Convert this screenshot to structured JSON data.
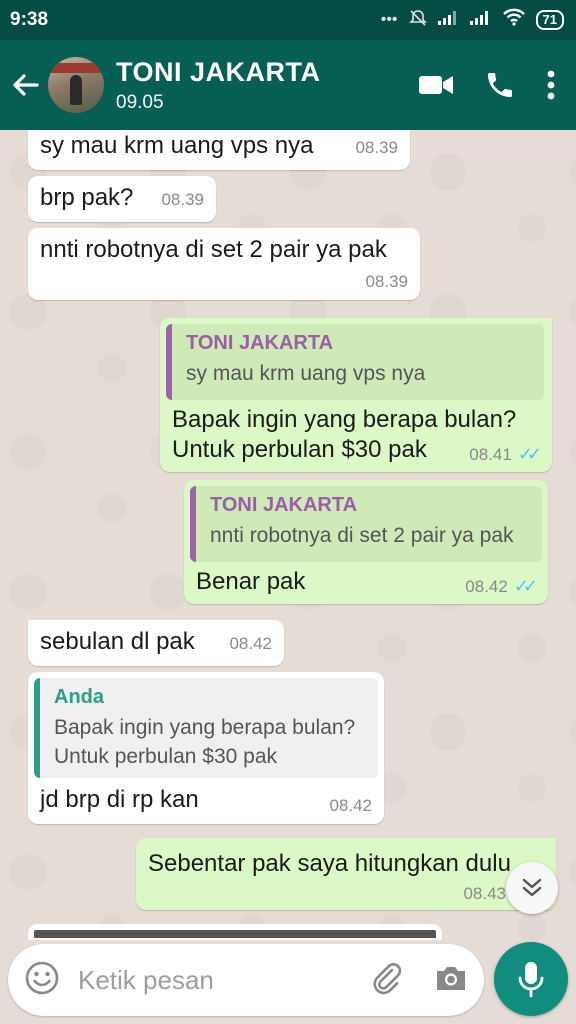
{
  "status_bar": {
    "time": "9:38",
    "dots": "•••",
    "battery": "71"
  },
  "header": {
    "contact_name": "TONI JAKARTA",
    "contact_status": "09.05"
  },
  "messages": [
    {
      "text": "sy mau krm uang vps nya",
      "time": "08.39"
    },
    {
      "text": "brp pak?",
      "time": "08.39"
    },
    {
      "text": "nnti robotnya di set 2 pair ya pak",
      "time": "08.39"
    },
    {
      "quote_author": "TONI JAKARTA",
      "quote_text": "sy mau krm uang vps nya",
      "text_line1": "Bapak ingin yang berapa bulan?",
      "text_line2": "Untuk perbulan $30 pak",
      "time": "08.41"
    },
    {
      "quote_author": "TONI JAKARTA",
      "quote_text": "nnti robotnya di set 2 pair ya pak",
      "text": "Benar pak",
      "time": "08.42"
    },
    {
      "text": "sebulan dl pak",
      "time": "08.42"
    },
    {
      "quote_author": "Anda",
      "quote_line1": "Bapak ingin yang berapa bulan?",
      "quote_line2": "Untuk perbulan $30 pak",
      "text": "jd brp di rp kan",
      "time": "08.42"
    },
    {
      "text": "Sebentar pak saya hitungkan dulu",
      "time": "08.43"
    }
  ],
  "input": {
    "placeholder": "Ketik pesan"
  },
  "icons": {
    "back": "arrow-back-icon",
    "video": "video-call-icon",
    "call": "phone-icon",
    "menu": "more-vert-icon",
    "emoji": "emoji-icon",
    "attach": "paperclip-icon",
    "camera": "camera-icon",
    "mic": "mic-icon",
    "scroll": "chevron-double-down-icon"
  },
  "colors": {
    "header": "#075e54",
    "status_bar": "#054d44",
    "outgoing": "#dcf8c6",
    "incoming": "#ffffff",
    "mic": "#128c7e",
    "read_ticks": "#4fc3f7"
  }
}
